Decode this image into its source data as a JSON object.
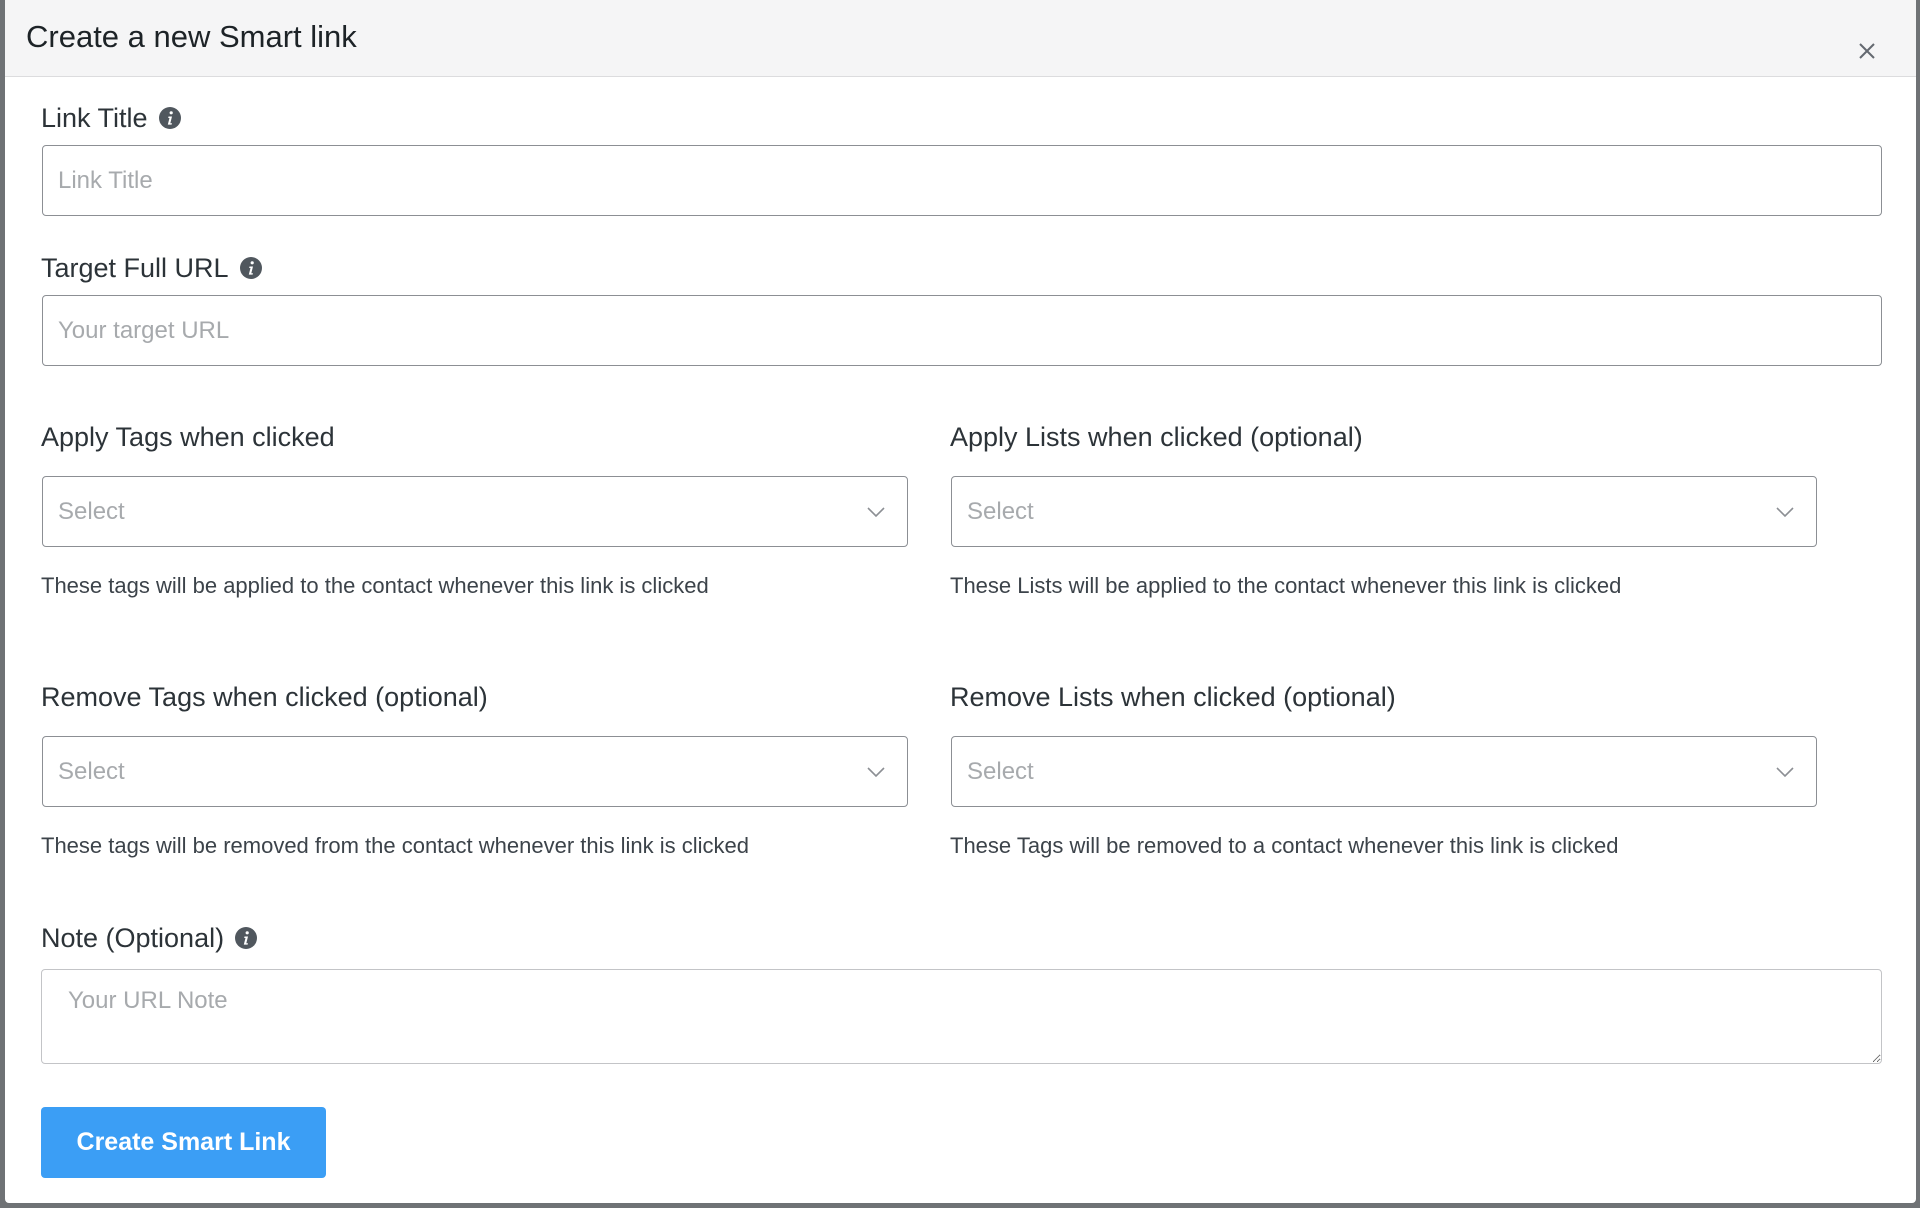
{
  "dialog": {
    "title": "Create a new Smart link",
    "close_icon": "close-icon"
  },
  "link_title": {
    "label": "Link Title",
    "placeholder": "Link Title",
    "value": ""
  },
  "target_url": {
    "label": "Target Full URL",
    "placeholder": "Your target URL",
    "value": ""
  },
  "apply_tags": {
    "label": "Apply Tags when clicked",
    "selected": "Select",
    "help": "These tags will be applied to the contact whenever this link is clicked"
  },
  "apply_lists": {
    "label": "Apply Lists when clicked (optional)",
    "selected": "Select",
    "help": "These Lists will be applied to the contact whenever this link is clicked"
  },
  "remove_tags": {
    "label": "Remove Tags when clicked (optional)",
    "selected": "Select",
    "help": "These tags will be removed from the contact whenever this link is clicked"
  },
  "remove_lists": {
    "label": "Remove Lists when clicked (optional)",
    "selected": "Select",
    "help": "These Tags will be removed to a contact whenever this link is clicked"
  },
  "note": {
    "label": "Note (Optional)",
    "placeholder": "Your URL Note",
    "value": ""
  },
  "submit": {
    "label": "Create Smart Link"
  },
  "colors": {
    "primary_button": "#3b9ef5",
    "header_bg": "#f5f5f6",
    "info_icon": "#50575e"
  }
}
